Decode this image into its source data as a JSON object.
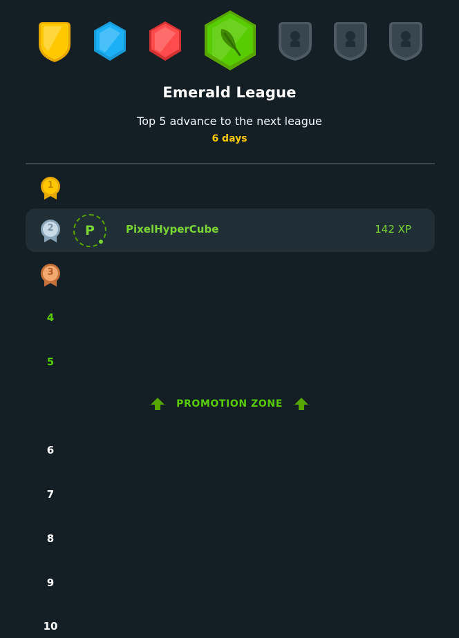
{
  "badges": [
    {
      "name": "gold-league-badge-icon",
      "state": "completed",
      "color": "#ffc800"
    },
    {
      "name": "sapphire-league-badge-icon",
      "state": "completed",
      "color": "#1cb0f6"
    },
    {
      "name": "ruby-league-badge-icon",
      "state": "completed",
      "color": "#ff4b4b"
    },
    {
      "name": "emerald-league-badge-icon",
      "state": "current",
      "color": "#58cc02"
    },
    {
      "name": "locked-league-badge-icon",
      "state": "locked",
      "color": "#4b5a63"
    },
    {
      "name": "locked-league-badge-icon",
      "state": "locked",
      "color": "#4b5a63"
    },
    {
      "name": "locked-league-badge-icon",
      "state": "locked",
      "color": "#4b5a63"
    }
  ],
  "league": {
    "title": "Emerald League",
    "subtitle": "Top 5 advance to the next league",
    "days_left": "6 days"
  },
  "leaderboard": {
    "rows": [
      {
        "rank": "1",
        "medal": "gold"
      },
      {
        "rank": "2",
        "medal": "silver",
        "highlight": true,
        "avatar_letter": "P",
        "name": "PixelHyperCube",
        "xp": "142 XP"
      },
      {
        "rank": "3",
        "medal": "bronze"
      },
      {
        "rank": "4",
        "zone": "promotion"
      },
      {
        "rank": "5",
        "zone": "promotion"
      },
      {
        "rank": "6"
      },
      {
        "rank": "7"
      },
      {
        "rank": "8"
      },
      {
        "rank": "9"
      },
      {
        "rank": "10"
      }
    ],
    "promotion_zone_label": "PROMOTION ZONE"
  },
  "colors": {
    "background": "#131f24",
    "highlight_row": "#202f36",
    "accent_green": "#58cc02",
    "days_yellow": "#ffc800"
  }
}
